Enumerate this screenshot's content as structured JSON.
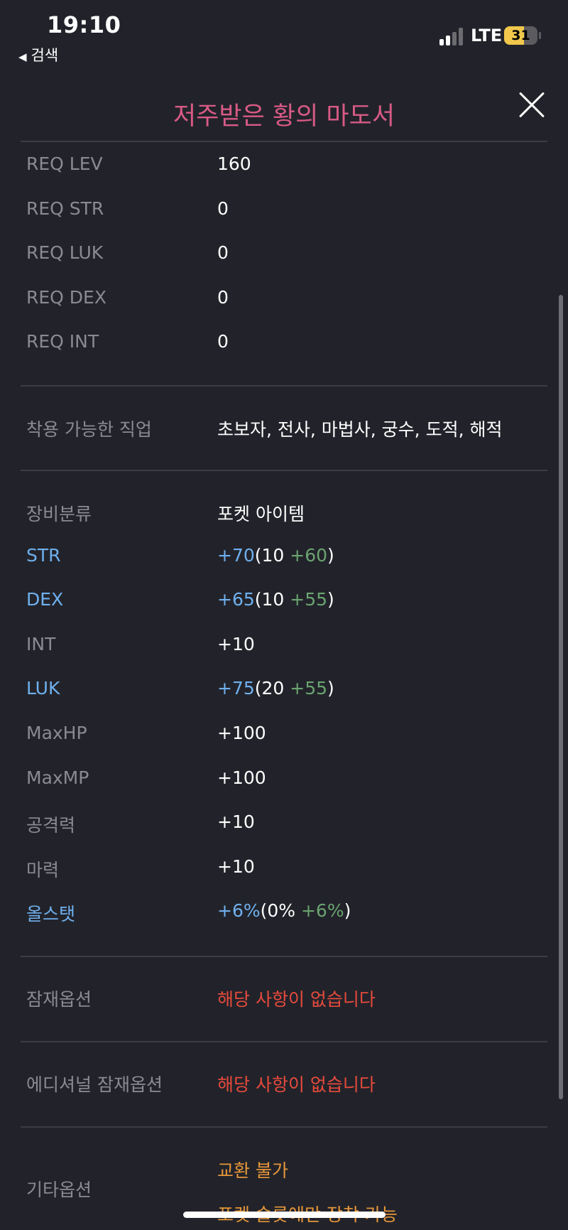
{
  "status": {
    "time": "19:10",
    "back_label": "검색",
    "network": "LTE",
    "battery": "31"
  },
  "title": "저주받은 황의 마도서",
  "requirements": [
    {
      "label": "REQ LEV",
      "value": "160"
    },
    {
      "label": "REQ STR",
      "value": "0"
    },
    {
      "label": "REQ LUK",
      "value": "0"
    },
    {
      "label": "REQ DEX",
      "value": "0"
    },
    {
      "label": "REQ INT",
      "value": "0"
    }
  ],
  "jobs": {
    "label": "착용 가능한 직업",
    "value": "초보자, 전사, 마법사, 궁수, 도적, 해적"
  },
  "category": {
    "label": "장비분류",
    "value": "포켓 아이템"
  },
  "stats": {
    "str": {
      "label": "STR",
      "total": "+70",
      "open": "(10 ",
      "bonus": "+60",
      "close": ")"
    },
    "dex": {
      "label": "DEX",
      "total": "+65",
      "open": "(10 ",
      "bonus": "+55",
      "close": ")"
    },
    "int": {
      "label": "INT",
      "value": "+10"
    },
    "luk": {
      "label": "LUK",
      "total": "+75",
      "open": "(20 ",
      "bonus": "+55",
      "close": ")"
    },
    "maxhp": {
      "label": "MaxHP",
      "value": "+100"
    },
    "maxmp": {
      "label": "MaxMP",
      "value": "+100"
    },
    "attack": {
      "label": "공격력",
      "value": "+10"
    },
    "magic": {
      "label": "마력",
      "value": "+10"
    },
    "allstat": {
      "label": "올스탯",
      "total": "+6%",
      "open": "(0% ",
      "bonus": "+6%",
      "close": ")"
    }
  },
  "potential": {
    "label": "잠재옵션",
    "value": "해당 사항이 없습니다"
  },
  "additional": {
    "label": "에디셔널 잠재옵션",
    "value": "해당 사항이 없습니다"
  },
  "etc": {
    "label": "기타옵션",
    "values": [
      "교환 불가",
      "포켓 슬롯에만 장착 가능"
    ]
  },
  "colors": {
    "title": "#d85a85",
    "highlight": "#6fb0ee",
    "bonus": "#6aa370",
    "none": "#e64a3c",
    "etc": "#e6963a"
  }
}
